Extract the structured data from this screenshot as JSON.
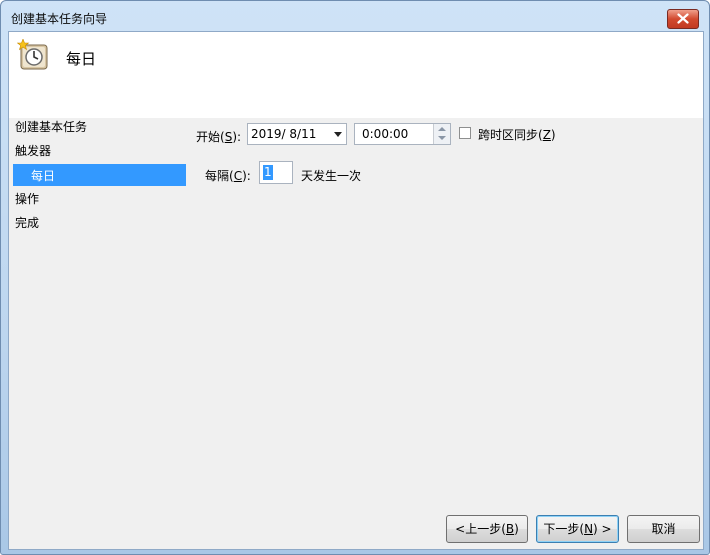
{
  "window": {
    "title": "创建基本任务向导"
  },
  "header": {
    "title": "每日"
  },
  "steps": [
    {
      "label": "创建基本任务"
    },
    {
      "label": "触发器"
    },
    {
      "label": "每日"
    },
    {
      "label": "操作"
    },
    {
      "label": "完成"
    }
  ],
  "start": {
    "label": "开始(",
    "accel": "S",
    "label_end": "):",
    "date": "2019/  8/11",
    "time": "0:00:00"
  },
  "sync": {
    "label": "跨时区同步(",
    "accel": "Z",
    "label_end": ")",
    "checked": false
  },
  "recur": {
    "label": "每隔(",
    "accel": "C",
    "label_end": "):",
    "value": "1",
    "suffix": "天发生一次"
  },
  "buttons": {
    "back": {
      "pre": "<上一步(",
      "accel": "B",
      "post": ")"
    },
    "next": {
      "pre": "下一步(",
      "accel": "N",
      "post": ") >"
    },
    "cancel": {
      "label": "取消"
    }
  }
}
